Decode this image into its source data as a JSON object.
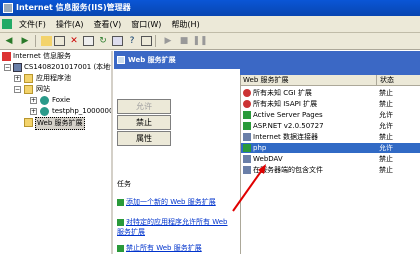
{
  "window": {
    "title": "Internet 信息服务(IIS)管理器"
  },
  "menu": [
    "文件(F)",
    "操作(A)",
    "查看(V)",
    "窗口(W)",
    "帮助(H)"
  ],
  "toolbar": {
    "icons": [
      "back-icon",
      "forward-icon",
      "up-folder-icon",
      "show-tree-icon",
      "delete-icon",
      "properties-icon",
      "refresh-icon",
      "export-icon",
      "help-icon",
      "console-icon",
      "play-icon",
      "stop-icon",
      "pause-icon"
    ]
  },
  "tree": {
    "root": "Internet 信息服务",
    "server": "CS1408201017001 (本地计",
    "app_pools": "应用程序池",
    "websites": "网站",
    "site1": "Foxie",
    "site2": "testphp_1000000",
    "web_ext": "Web 服务扩展"
  },
  "panel": {
    "header": "Web 服务扩展",
    "buttons": {
      "allow": "允许",
      "prohibit": "禁止",
      "properties": "属性"
    },
    "tasks_title": "任务",
    "tasks": [
      "添加一个新的 Web 服务扩展",
      "对特定的应用程序允许所有 Web 服务扩展",
      "禁止所有 Web 服务扩展"
    ]
  },
  "list": {
    "columns": [
      "Web 服务扩展",
      "状态"
    ],
    "rows": [
      {
        "name": "所有未知 CGI 扩展",
        "status": "禁止",
        "icon": "prohibit-icon"
      },
      {
        "name": "所有未知 ISAPI 扩展",
        "status": "禁止",
        "icon": "prohibit-icon"
      },
      {
        "name": "Active Server Pages",
        "status": "允许",
        "icon": "allowed-icon"
      },
      {
        "name": "ASP.NET v2.0.50727",
        "status": "允许",
        "icon": "allowed-icon"
      },
      {
        "name": "Internet 数据连接器",
        "status": "禁止",
        "icon": "gear-icon"
      },
      {
        "name": "php",
        "status": "允许",
        "icon": "allowed-icon"
      },
      {
        "name": "WebDAV",
        "status": "禁止",
        "icon": "gear-icon"
      },
      {
        "name": "在服务器端的包含文件",
        "status": "禁止",
        "icon": "gear-icon"
      }
    ],
    "selected_index": 5
  },
  "annotation": {
    "color": "#e00000"
  }
}
